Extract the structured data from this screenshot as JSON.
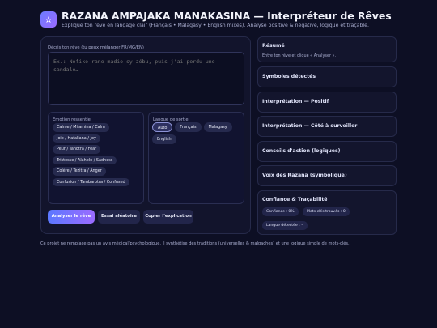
{
  "header": {
    "logo_glyph": "✫",
    "title": "RAZANA AMPAJAKA MANAKASINA — Interpréteur de Rêves",
    "subtitle": "Explique ton rêve en langage clair (Français • Malagasy • English mixés). Analyse positive & négative, logique et traçable."
  },
  "form": {
    "dream_label": "Décris ton rêve (tu peux mélanger FR/MG/EN)",
    "dream_placeholder": "Ex.: Nofiko rano madio sy zébu, puis j'ai perdu une sandale…",
    "emotion_label": "Émotion ressentie",
    "emotions": [
      "Calme / Milamina / Calm",
      "Joie / Hafaliana / Joy",
      "Peur / Tahotra / Fear",
      "Tristesse / Alahelo / Sadness",
      "Colère / Tezitra / Anger",
      "Confusion / Tambarotra / Confused"
    ],
    "language_label": "Langue de sortie",
    "languages": [
      "Auto",
      "Français",
      "Malagasy",
      "English"
    ],
    "buttons": {
      "analyze": "Analyser le rêve",
      "example": "Essai aléatoire",
      "copy": "Copier l'explication"
    }
  },
  "footer": "Ce projet ne remplace pas un avis médical/psychologique. Il synthétise des traditions (universelles & malgaches) et une logique simple de mots-clés.",
  "results": {
    "summary_title": "Résumé",
    "summary_text": "Entre ton rêve et clique « Analyser ».",
    "symbols_title": "Symboles détectés",
    "positive_title": "Interprétation — Positif",
    "negative_title": "Interprétation — Côté à surveiller",
    "advice_title": "Conseils d'action (logiques)",
    "razana_title": "Voix des Razana (symbolique)",
    "trace_title": "Confiance & Traçabilité",
    "confidence": "Confiance : 0%",
    "keywords": "Mots-clés trouvés : 0",
    "language_detected": "Langue détectée : –"
  }
}
